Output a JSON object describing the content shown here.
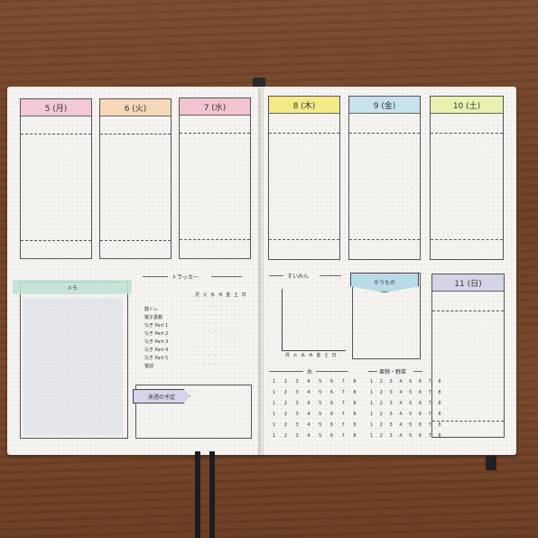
{
  "days": [
    {
      "label": "5 (月)",
      "color": "#f3c9d8"
    },
    {
      "label": "6 (火)",
      "color": "#f6d8b8"
    },
    {
      "label": "7 (水)",
      "color": "#f3c4cf"
    },
    {
      "label": "8 (木)",
      "color": "#f4ea86"
    },
    {
      "label": "9 (金)",
      "color": "#c8e2ea"
    },
    {
      "label": "10 (土)",
      "color": "#eaf1b0"
    },
    {
      "label": "11 (日)",
      "color": "#d4d4e6"
    }
  ],
  "memo": {
    "title": "メモ"
  },
  "tracker": {
    "title": "トラッカー",
    "days_header": "月 火 水 木 金 土 日",
    "items": [
      "筋トレ",
      "電子書籍",
      "なぎ Part 1",
      "なぎ Part 2",
      "なぎ Part 3",
      "なぎ Part 4",
      "なぎ Part 5",
      "電話"
    ]
  },
  "sleep": {
    "title": "すいみん",
    "x_labels": "月 火 水 木 金 土 日"
  },
  "shopping": {
    "title": "かうもの"
  },
  "next_week": {
    "title": "来週の予定"
  },
  "water": {
    "title": "水"
  },
  "fruit": {
    "title": "果物・野菜"
  },
  "number_row": "1 2 3 4 5 6 7 8"
}
